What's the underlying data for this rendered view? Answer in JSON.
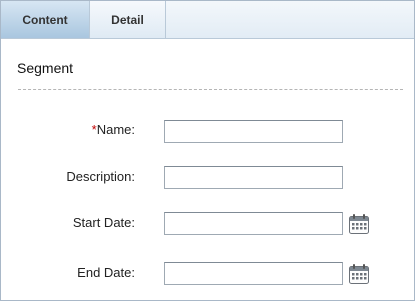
{
  "tabs": [
    {
      "label": "Content",
      "active": true
    },
    {
      "label": "Detail",
      "active": false
    }
  ],
  "section": {
    "title": "Segment"
  },
  "form": {
    "name": {
      "required_marker": "*",
      "label": "Name:",
      "value": ""
    },
    "description": {
      "label": "Description:",
      "value": ""
    },
    "start_date": {
      "label": "Start Date:",
      "value": "",
      "icon": "calendar-icon"
    },
    "end_date": {
      "label": "End Date:",
      "value": "",
      "icon": "calendar-icon"
    }
  },
  "colors": {
    "tab_active": "#a9c6df",
    "required": "#c00000",
    "border": "#a9b8c8"
  }
}
